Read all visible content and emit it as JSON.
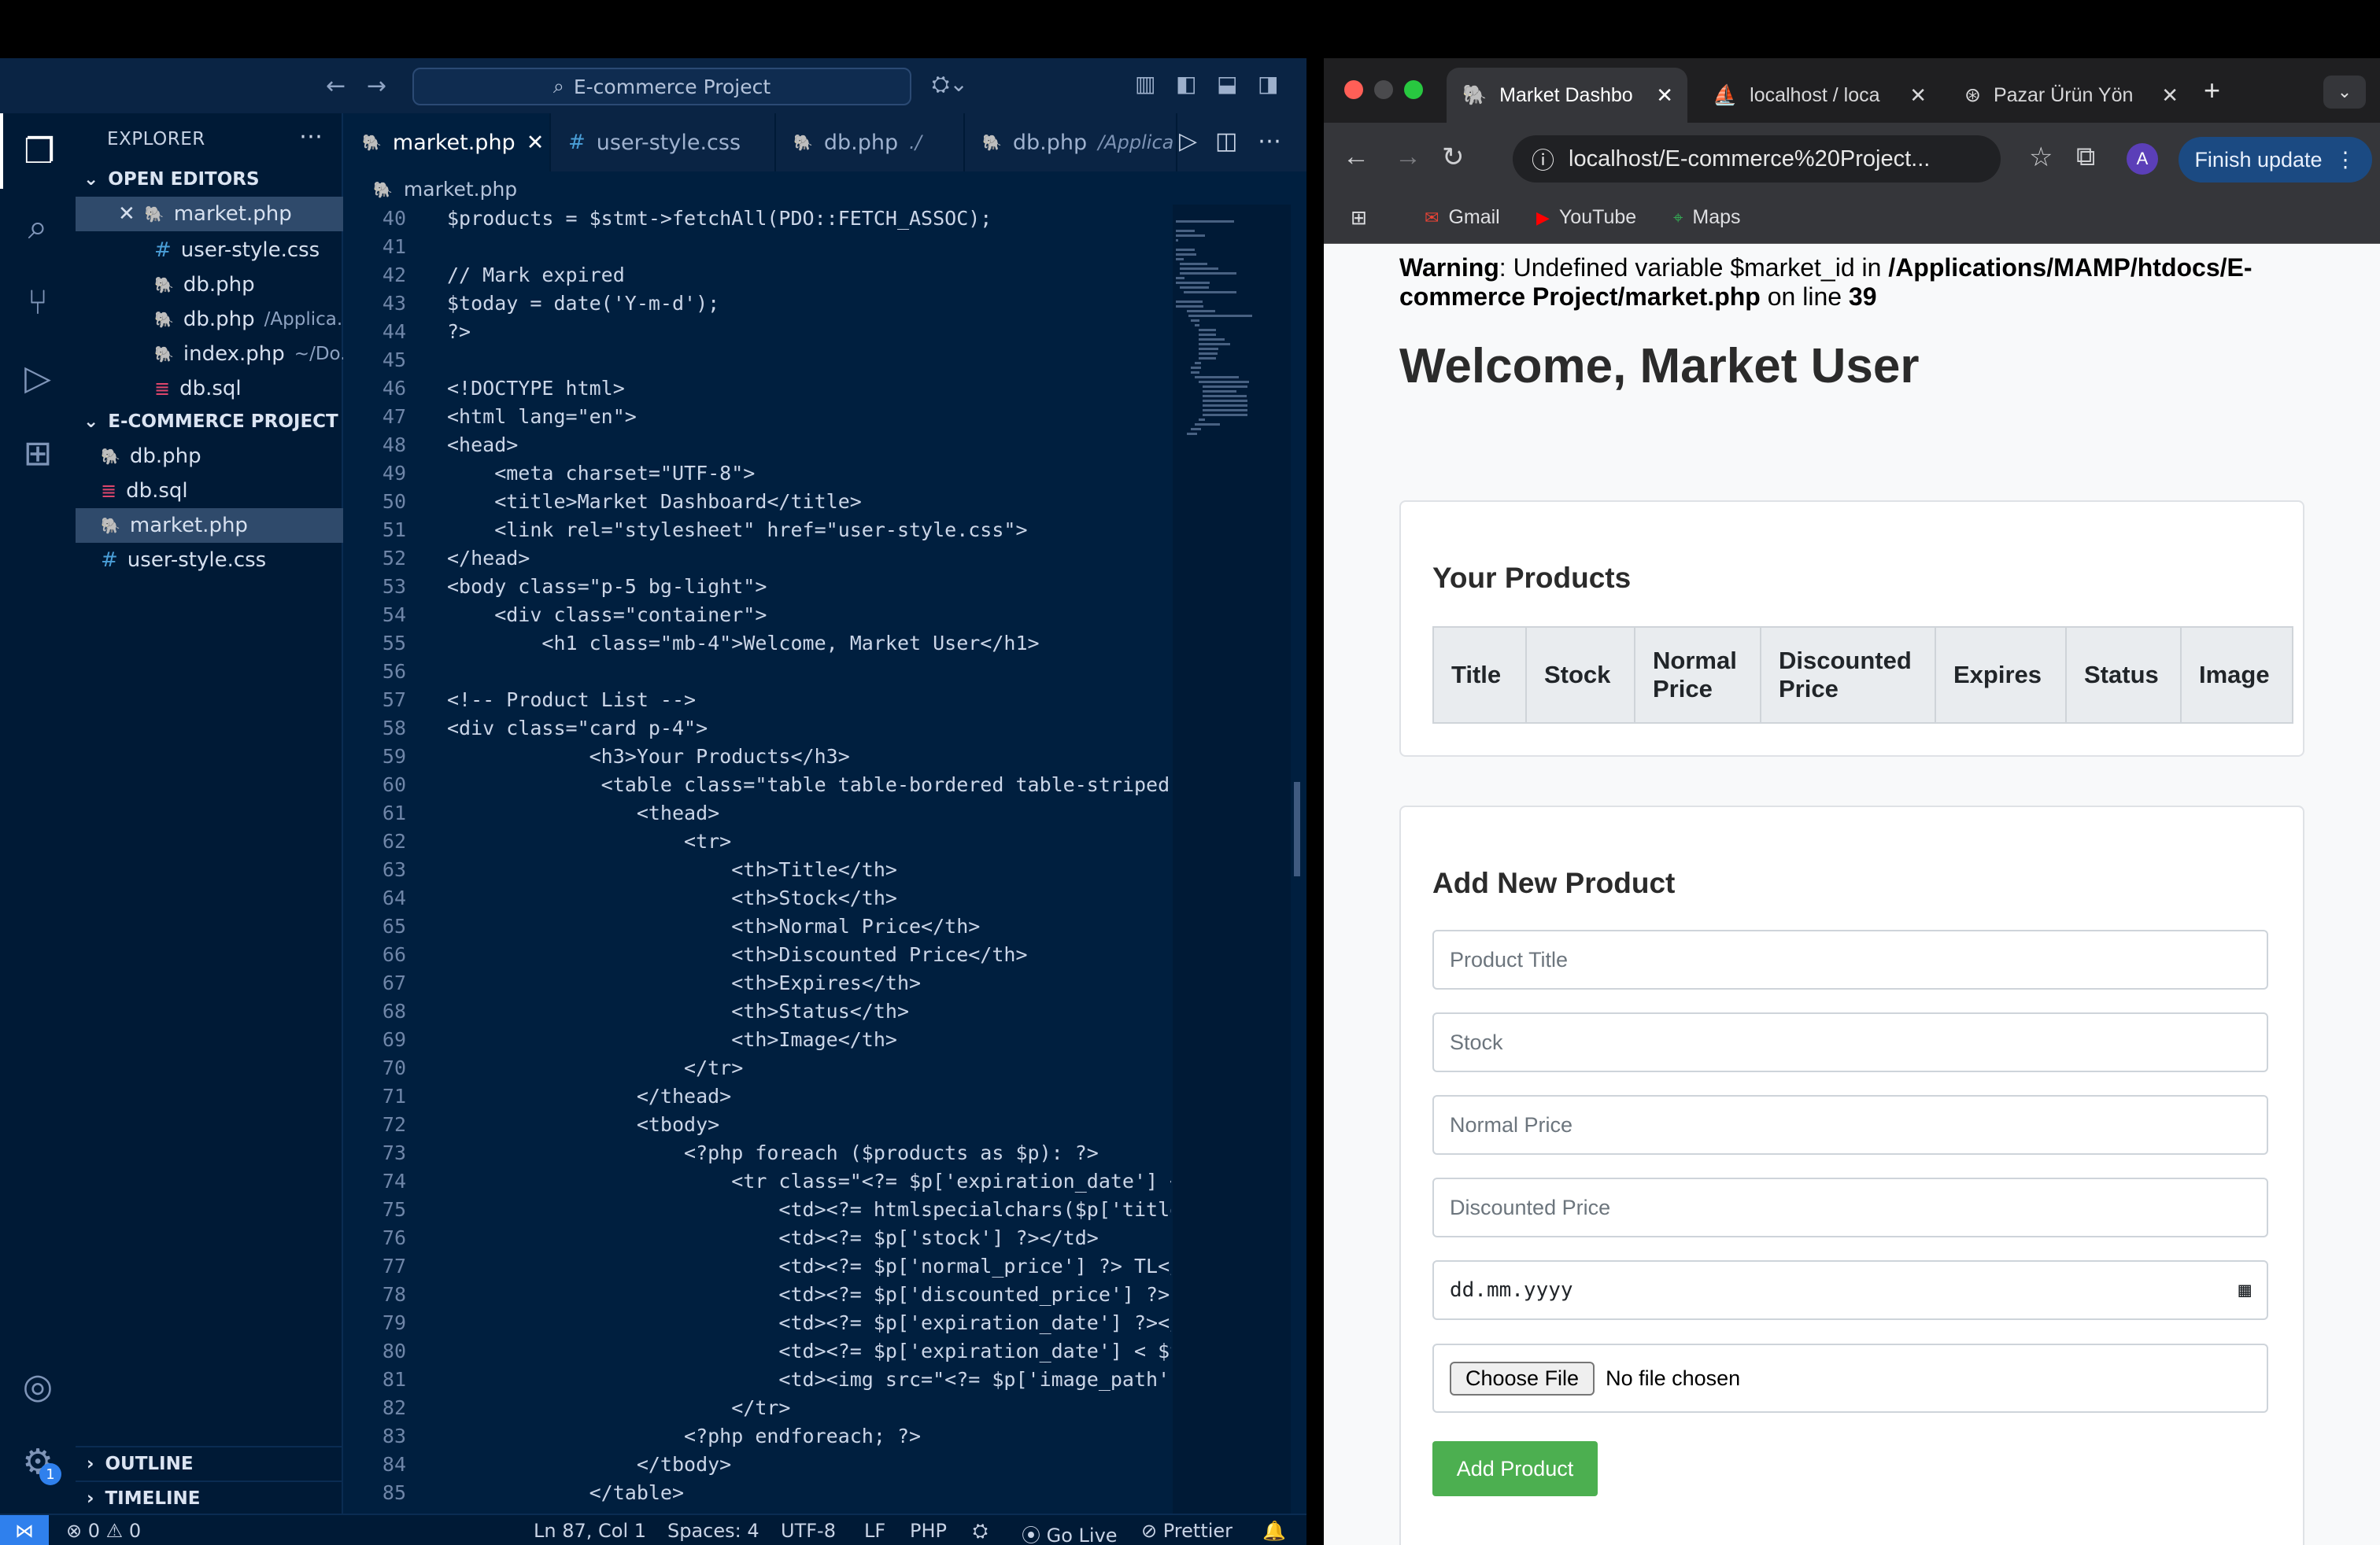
{
  "vscode": {
    "search": "E-commerce Project",
    "sidebar": {
      "header": "EXPLORER",
      "open_editors_label": "OPEN EDITORS",
      "open_editors": [
        {
          "name": "market.php",
          "path": "",
          "type": "php"
        },
        {
          "name": "user-style.css",
          "path": "",
          "type": "css"
        },
        {
          "name": "db.php",
          "path": "",
          "type": "php"
        },
        {
          "name": "db.php",
          "path": "/Applica...",
          "type": "php"
        },
        {
          "name": "index.php",
          "path": "~/Do...",
          "type": "php"
        },
        {
          "name": "db.sql",
          "path": "",
          "type": "sql"
        }
      ],
      "project_label": "E-COMMERCE PROJECT",
      "project_files": [
        {
          "name": "db.php",
          "type": "php"
        },
        {
          "name": "db.sql",
          "type": "sql"
        },
        {
          "name": "market.php",
          "type": "php"
        },
        {
          "name": "user-style.css",
          "type": "css"
        }
      ],
      "outline": "OUTLINE",
      "timeline": "TIMELINE"
    },
    "tabs": [
      {
        "label": "market.php",
        "path": ""
      },
      {
        "label": "user-style.css",
        "path": ""
      },
      {
        "label": "db.php",
        "path": "./"
      },
      {
        "label": "db.php",
        "path": "/Applica"
      }
    ],
    "breadcrumb": "market.php",
    "code": [
      {
        "n": "40",
        "t": "$products = $stmt->fetchAll(PDO::FETCH_ASSOC);"
      },
      {
        "n": "41",
        "t": ""
      },
      {
        "n": "42",
        "t": "// Mark expired"
      },
      {
        "n": "43",
        "t": "$today = date('Y-m-d');"
      },
      {
        "n": "44",
        "t": "?>"
      },
      {
        "n": "45",
        "t": ""
      },
      {
        "n": "46",
        "t": "<!DOCTYPE html>"
      },
      {
        "n": "47",
        "t": "<html lang=\"en\">"
      },
      {
        "n": "48",
        "t": "<head>"
      },
      {
        "n": "49",
        "t": "    <meta charset=\"UTF-8\">"
      },
      {
        "n": "50",
        "t": "    <title>Market Dashboard</title>"
      },
      {
        "n": "51",
        "t": "    <link rel=\"stylesheet\" href=\"user-style.css\">"
      },
      {
        "n": "52",
        "t": "</head>"
      },
      {
        "n": "53",
        "t": "<body class=\"p-5 bg-light\">"
      },
      {
        "n": "54",
        "t": "    <div class=\"container\">"
      },
      {
        "n": "55",
        "t": "        <h1 class=\"mb-4\">Welcome, Market User</h1>"
      },
      {
        "n": "56",
        "t": ""
      },
      {
        "n": "57",
        "t": "<!-- Product List -->"
      },
      {
        "n": "58",
        "t": "<div class=\"card p-4\">"
      },
      {
        "n": "59",
        "t": "            <h3>Your Products</h3>"
      },
      {
        "n": "60",
        "t": "             <table class=\"table table-bordered table-striped mt"
      },
      {
        "n": "61",
        "t": "                <thead>"
      },
      {
        "n": "62",
        "t": "                    <tr>"
      },
      {
        "n": "63",
        "t": "                        <th>Title</th>"
      },
      {
        "n": "64",
        "t": "                        <th>Stock</th>"
      },
      {
        "n": "65",
        "t": "                        <th>Normal Price</th>"
      },
      {
        "n": "66",
        "t": "                        <th>Discounted Price</th>"
      },
      {
        "n": "67",
        "t": "                        <th>Expires</th>"
      },
      {
        "n": "68",
        "t": "                        <th>Status</th>"
      },
      {
        "n": "69",
        "t": "                        <th>Image</th>"
      },
      {
        "n": "70",
        "t": "                    </tr>"
      },
      {
        "n": "71",
        "t": "                </thead>"
      },
      {
        "n": "72",
        "t": "                <tbody>"
      },
      {
        "n": "73",
        "t": "                    <?php foreach ($products as $p): ?>"
      },
      {
        "n": "74",
        "t": "                        <tr class=\"<?= $p['expiration_date'] < $"
      },
      {
        "n": "75",
        "t": "                            <td><?= htmlspecialchars($p['title']"
      },
      {
        "n": "76",
        "t": "                            <td><?= $p['stock'] ?></td>"
      },
      {
        "n": "77",
        "t": "                            <td><?= $p['normal_price'] ?> TL</t"
      },
      {
        "n": "78",
        "t": "                            <td><?= $p['discounted_price'] ?> TL"
      },
      {
        "n": "79",
        "t": "                            <td><?= $p['expiration_date'] ?></td"
      },
      {
        "n": "80",
        "t": "                            <td><?= $p['expiration_date'] < $too"
      },
      {
        "n": "81",
        "t": "                            <td><img src=\"<?= $p['image_path'] ?"
      },
      {
        "n": "82",
        "t": "                        </tr>"
      },
      {
        "n": "83",
        "t": "                    <?php endforeach; ?>"
      },
      {
        "n": "84",
        "t": "                </tbody>"
      },
      {
        "n": "85",
        "t": "            </table>"
      }
    ],
    "status": {
      "errors": "0",
      "warnings": "0",
      "position": "Ln 87, Col 1",
      "spaces": "Spaces: 4",
      "encoding": "UTF-8",
      "eol": "LF",
      "language": "PHP",
      "golive": "Go Live",
      "prettier": "Prettier"
    },
    "settings_badge": "1"
  },
  "chrome": {
    "tabs": [
      {
        "label": "Market Dashbo"
      },
      {
        "label": "localhost / loca"
      },
      {
        "label": "Pazar Ürün Yön"
      }
    ],
    "url": "localhost/E-commerce%20Project...",
    "avatar": "A",
    "finish_update": "Finish update",
    "bookmarks": [
      "Gmail",
      "YouTube",
      "Maps"
    ],
    "page": {
      "warning_label": "Warning",
      "warning_text": ": Undefined variable $market_id in ",
      "warning_path": "/Applications/MAMP/htdocs/E-commerce Project/market.php",
      "warning_line_text": " on line ",
      "warning_line": "39",
      "welcome": "Welcome, Market User",
      "products_title": "Your Products",
      "columns": [
        "Title",
        "Stock",
        "Normal Price",
        "Discounted Price",
        "Expires",
        "Status",
        "Image"
      ],
      "add_title": "Add New Product",
      "placeholders": {
        "title": "Product Title",
        "stock": "Stock",
        "normal_price": "Normal Price",
        "discounted_price": "Discounted Price"
      },
      "date_placeholder": "dd.mm.yyyy",
      "choose_file": "Choose File",
      "no_file": "No file chosen",
      "add_button": "Add Product"
    }
  },
  "colors": {
    "editor_bg": "#001f3f",
    "add_button": "#4caf50",
    "finish_update": "#1b4a82"
  }
}
